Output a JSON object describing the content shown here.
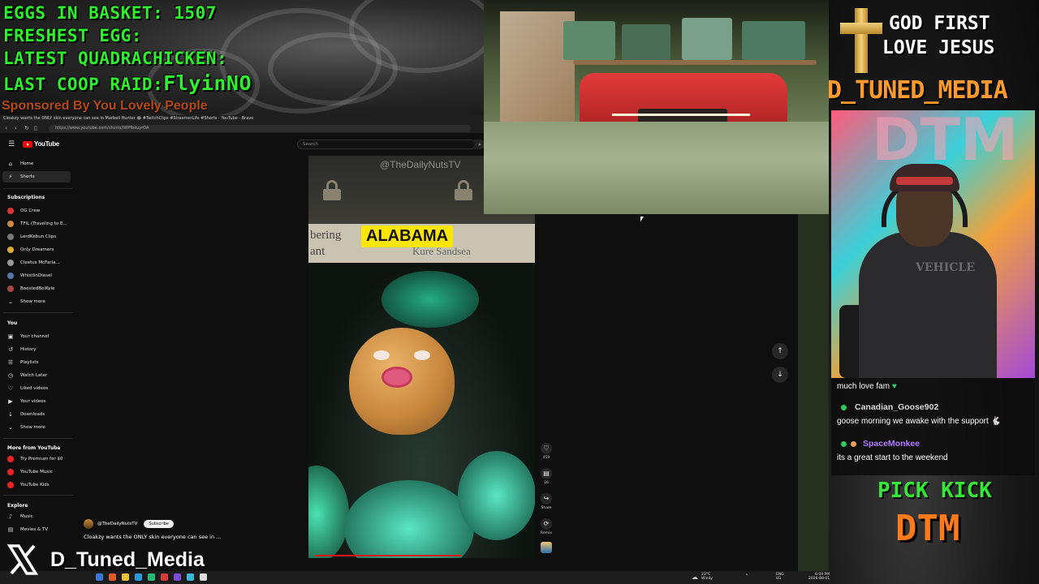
{
  "overlay_top_left": {
    "eggs_label": "EGGS IN BASKET: 1507",
    "freshest_label": "FRESHEST EGG:",
    "quadrachicken_label": "LATEST QUADRACHICKEN:",
    "coop_raid_label": "LAST COOP RAID:",
    "coop_raid_value": "FlyinNO",
    "sponsored": "Sponsored By You Lovely People"
  },
  "browser": {
    "tab_title": "Cloakzy wants the ONLY skin everyone can see in Marbell Hunter 😂 #TwitchClips #StreamerLife #Shorts - YouTube - Brave",
    "url": "https://www.youtube.com/shorts/IWPfbkuyrOA"
  },
  "youtube": {
    "logo_text": "YouTube",
    "search_placeholder": "Search",
    "sidebar": {
      "home": "Home",
      "shorts": "Shorts",
      "subscriptions_header": "Subscriptions",
      "subscriptions": [
        {
          "label": "OG Crew",
          "color": "#d33"
        },
        {
          "label": "TFIL (Traveling to E...",
          "color": "#c84"
        },
        {
          "label": "LordKebun Clips",
          "color": "#777"
        },
        {
          "label": "Only Dreamers",
          "color": "#da3"
        },
        {
          "label": "Cleetus McFarla...",
          "color": "#999"
        },
        {
          "label": "WhistlinDiesel",
          "color": "#57a"
        },
        {
          "label": "BoostedBoiKyle",
          "color": "#a44"
        }
      ],
      "show_more": "Show more",
      "you_header": "You",
      "you_items": [
        {
          "label": "Your channel",
          "icon": "▣"
        },
        {
          "label": "History",
          "icon": "↺"
        },
        {
          "label": "Playlists",
          "icon": "☰"
        },
        {
          "label": "Watch Later",
          "icon": "◷"
        },
        {
          "label": "Liked videos",
          "icon": "♡"
        },
        {
          "label": "Your videos",
          "icon": "▶"
        },
        {
          "label": "Downloads",
          "icon": "↓"
        }
      ],
      "show_more_2": "Show more",
      "more_header": "More from YouTube",
      "more_items": [
        {
          "label": "Try Premium for $0",
          "color": "#e22"
        },
        {
          "label": "YouTube Music",
          "color": "#e22"
        },
        {
          "label": "YouTube Kids",
          "color": "#e22"
        }
      ],
      "explore_header": "Explore",
      "explore_items": [
        {
          "label": "Music",
          "icon": "♪"
        },
        {
          "label": "Movies & TV",
          "icon": "▤"
        }
      ]
    },
    "short": {
      "watermark": "@TheDailyNutsTV",
      "caption_left_1": "bering",
      "caption_left_2": "ant",
      "caption_right": "Kure Sandsea",
      "overlay_label": "ALABAMA",
      "channel": "@TheDailyNutsTV",
      "subscribe": "Subscribe",
      "title": "Cloakzy wants the ONLY skin everyone can see in ..."
    },
    "actions": {
      "like_count": "459",
      "comment_count": "16",
      "share_label": "Share",
      "remix_label": "Remix"
    }
  },
  "right_panel": {
    "line1": "GOD FIRST",
    "line2": "LOVE JESUS",
    "channel": "D_TUNED_MEDIA",
    "pick_kick": "PICK KICK",
    "dtm": "DTM",
    "cam_logo": "DTM",
    "shirt_text": "VEHICLE"
  },
  "chat": [
    {
      "text": "much love fam"
    },
    {
      "user": "Canadian_Goose902",
      "user_color": "#d8d8d8",
      "text": "goose morning we awake with the support"
    },
    {
      "user": "SpaceMonkee",
      "user_color": "#b37bff",
      "text": "its a great start to the weekend"
    }
  ],
  "social": {
    "x_handle": "D_Tuned_Media"
  },
  "taskbar": {
    "weather_temp": "23°C",
    "weather_desc": "Windy",
    "lang_1": "ENG",
    "lang_2": "US",
    "time": "6:09 PM",
    "date": "2026-08-01"
  }
}
